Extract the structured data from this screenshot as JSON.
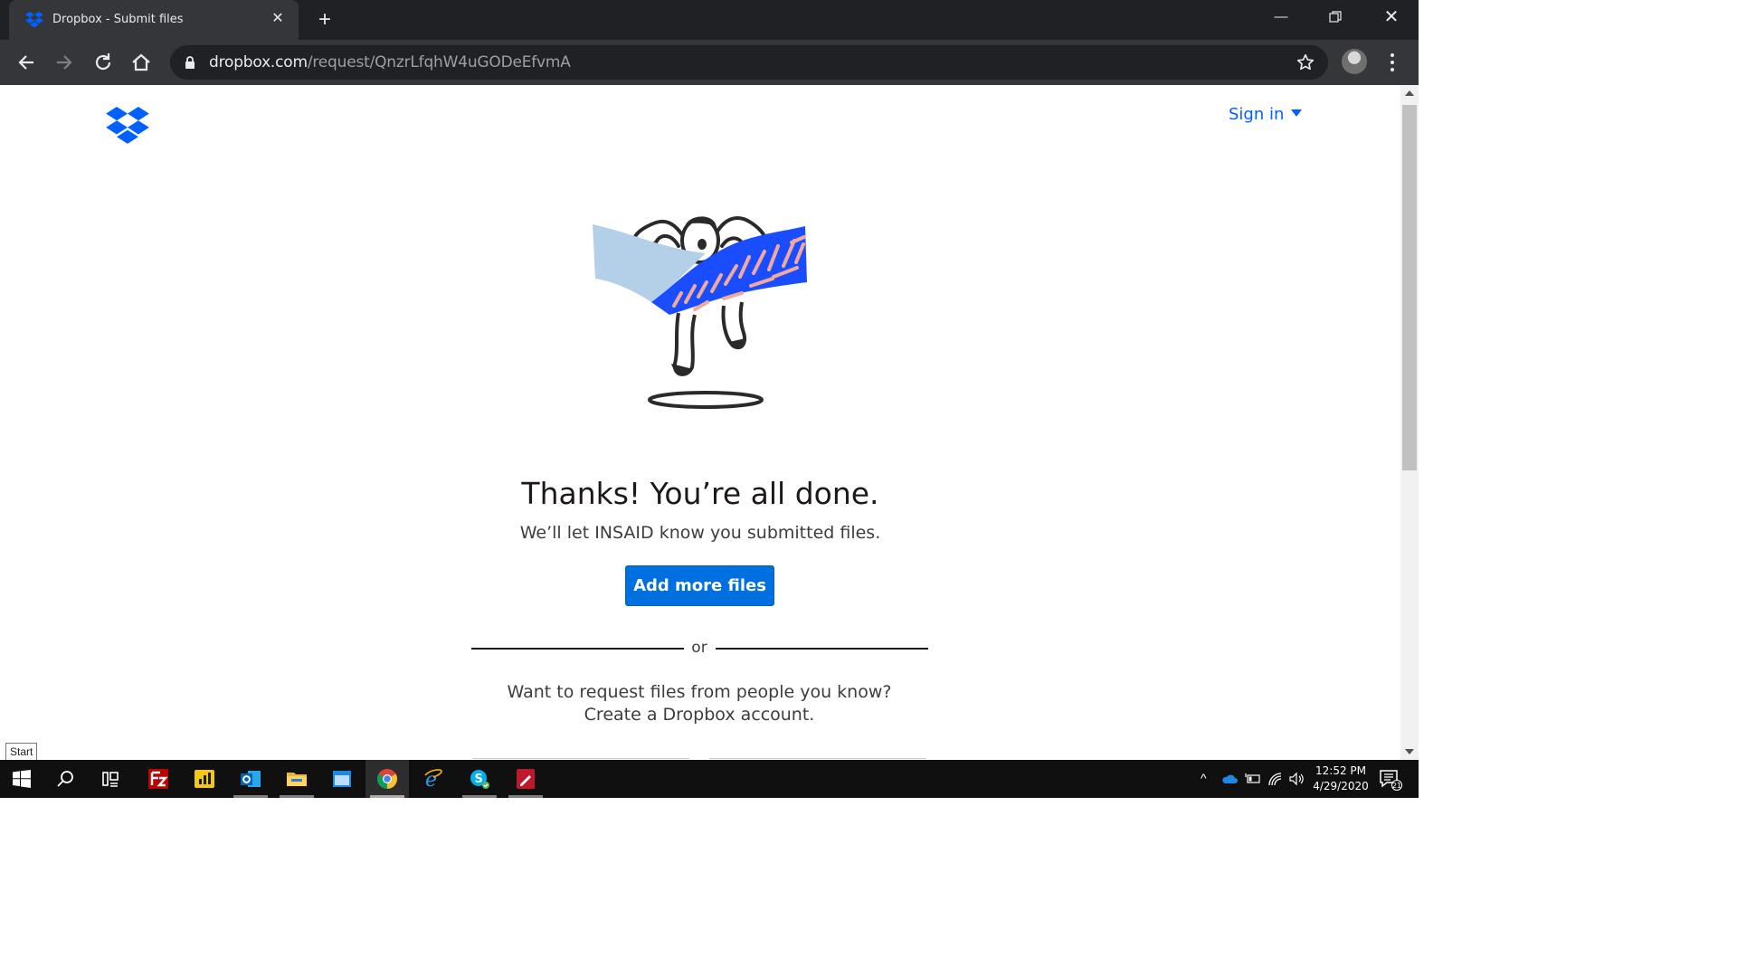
{
  "browser": {
    "tab_title": "Dropbox - Submit files",
    "url_host": "dropbox.com",
    "url_path": "/request/QnzrLfqhW4uGODeEfvmA"
  },
  "page": {
    "signin_label": "Sign in",
    "headline": "Thanks! You’re all done.",
    "subline": "We’ll let INSAID know you submitted files.",
    "add_more_label": "Add more files",
    "or_label": "or",
    "request_text": "Want to request files from people you know? Create a Dropbox account."
  },
  "taskbar": {
    "start_tooltip": "Start",
    "time": "12:52 PM",
    "date": "4/29/2020",
    "notification_count": "21",
    "apps": [
      "filezilla-icon",
      "power-bi-icon",
      "outlook-icon",
      "file-explorer-icon",
      "window-app-icon",
      "chrome-icon",
      "internet-explorer-icon",
      "skype-icon",
      "pdf-editor-icon"
    ]
  },
  "colors": {
    "dropbox_blue": "#0061fe",
    "button_blue": "#0070e0",
    "chrome_dark": "#202124",
    "chrome_toolbar": "#35363a",
    "taskbar": "#101010"
  }
}
